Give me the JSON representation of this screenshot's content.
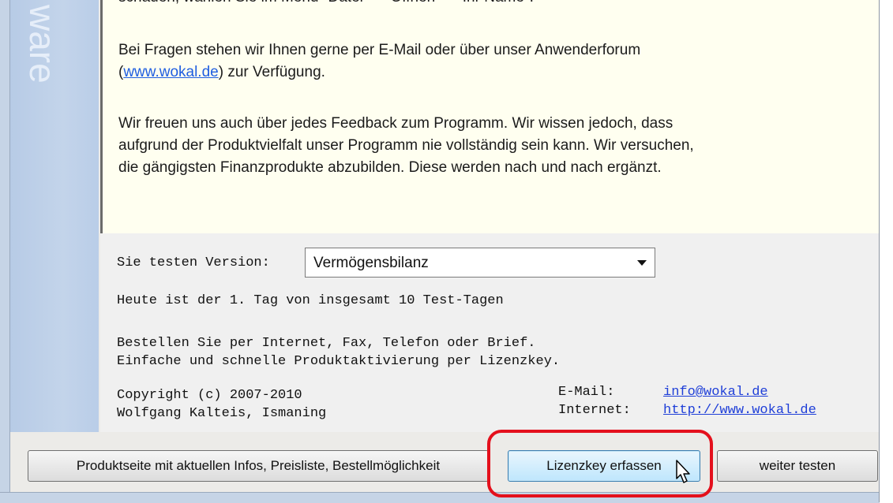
{
  "sidebar": {
    "vertical_text": "Share­ware"
  },
  "info": {
    "cut_line": "schauen, wählen Sie im Menü \"Datei\" – \"Offnen\" – \"Ihr Name\".",
    "p1_a": "Bei Fragen stehen wir Ihnen gerne per E-Mail oder über unser Anwenderforum",
    "p1_link": "www.wokal.de",
    "p1_b_open": "(",
    "p1_b_close": ") zur Verfügung.",
    "p2_l1": "Wir freuen uns auch über jedes Feedback zum Programm. Wir wissen jedoch, dass",
    "p2_l2": "aufgrund der Produktvielfalt unser Programm nie vollständig sein kann. Wir versuchen,",
    "p2_l3": "die gängigsten Finanzprodukte abzubilden. Diese werden nach und nach ergänzt."
  },
  "version": {
    "label": "Sie testen Version:",
    "selected": "Vermögensbilanz"
  },
  "trial": {
    "text": "Heute ist der 1. Tag von insgesamt 10 Test-Tagen"
  },
  "order": {
    "l1": "Bestellen Sie per Internet, Fax, Telefon oder Brief.",
    "l2": "Einfache und schnelle Produktaktivierung per Lizenzkey."
  },
  "copyright": {
    "l1": "Copyright (c) 2007-2010",
    "l2": "Wolfgang Kalteis, Ismaning"
  },
  "contact": {
    "email_label": "E-Mail:",
    "email": "info@wokal.de",
    "internet_label": "Internet:",
    "url": "http://www.wokal.de"
  },
  "buttons": {
    "product_page": "Produktseite mit aktuellen Infos, Preisliste, Bestellmöglichkeit",
    "license": "Lizenzkey erfassen",
    "continue": "weiter testen"
  },
  "colors": {
    "highlight": "#e4101c",
    "link": "#1f3fd8",
    "info_bg": "#fffff0"
  }
}
